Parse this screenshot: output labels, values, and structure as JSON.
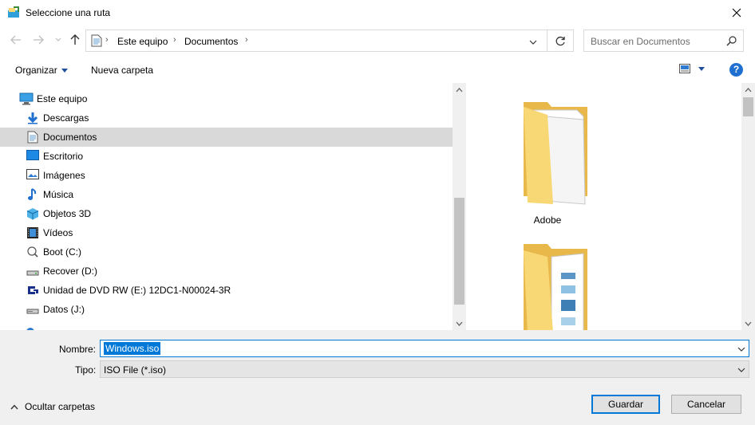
{
  "window": {
    "title": "Seleccione una ruta"
  },
  "address": {
    "crumbs": [
      "Este equipo",
      "Documentos"
    ]
  },
  "search": {
    "placeholder": "Buscar en Documentos"
  },
  "toolbar": {
    "organize_label": "Organizar",
    "new_folder_label": "Nueva carpeta",
    "help_label": "?"
  },
  "nav": {
    "items": [
      {
        "label": "Este equipo",
        "icon": "pc-icon"
      },
      {
        "label": "Descargas",
        "icon": "download-icon"
      },
      {
        "label": "Documentos",
        "icon": "document-icon",
        "selected": true
      },
      {
        "label": "Escritorio",
        "icon": "desktop-icon"
      },
      {
        "label": "Imágenes",
        "icon": "pictures-icon"
      },
      {
        "label": "Música",
        "icon": "music-icon"
      },
      {
        "label": "Objetos 3D",
        "icon": "cube-icon"
      },
      {
        "label": "Vídeos",
        "icon": "video-icon"
      },
      {
        "label": "Boot (C:)",
        "icon": "drive-icon"
      },
      {
        "label": "Recover (D:)",
        "icon": "drive-icon"
      },
      {
        "label": "Unidad de DVD RW (E:) 12DC1-N00024-3R",
        "icon": "dvd-icon"
      },
      {
        "label": "Datos (J:)",
        "icon": "drive-icon"
      }
    ]
  },
  "content": {
    "folders": [
      {
        "label": "Adobe"
      },
      {
        "label": ""
      }
    ]
  },
  "form": {
    "name_label": "Nombre:",
    "name_value": "Windows.iso",
    "type_label": "Tipo:",
    "type_value": "ISO File (*.iso)"
  },
  "footer": {
    "hide_folders_label": "Ocultar carpetas",
    "save_label": "Guardar",
    "cancel_label": "Cancelar"
  },
  "colors": {
    "accent": "#0078d7",
    "selection": "#d9d9d9",
    "folder": "#f8d775"
  }
}
